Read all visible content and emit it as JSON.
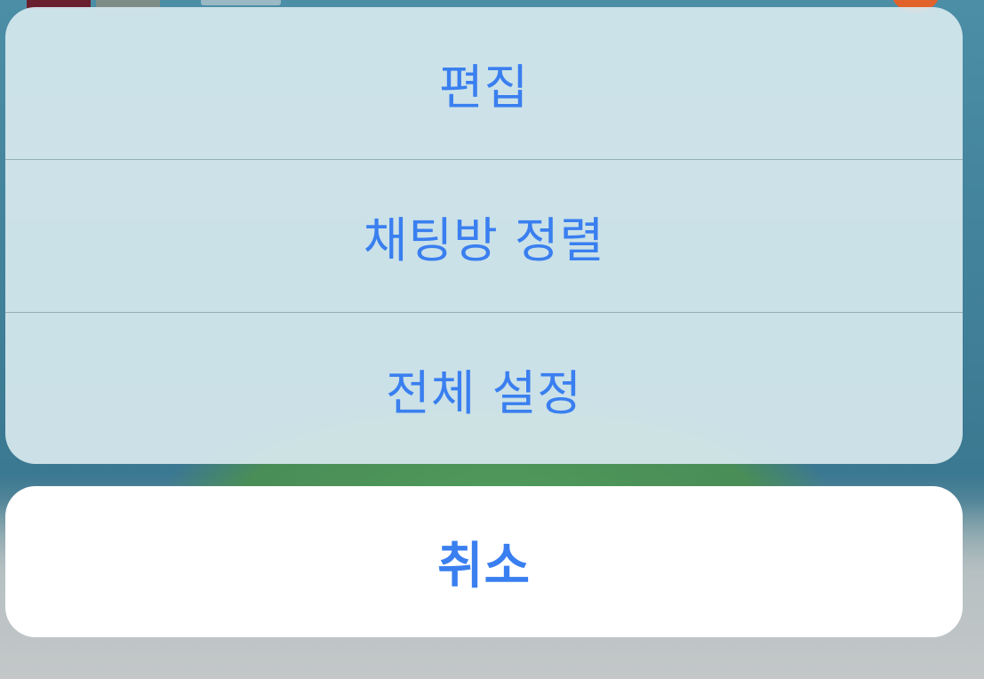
{
  "action_sheet": {
    "items": [
      {
        "label": "편집"
      },
      {
        "label": "채팅방 정렬"
      },
      {
        "label": "전체 설정"
      }
    ],
    "cancel_label": "취소"
  },
  "colors": {
    "accent": "#3a7ff0",
    "group_background": "#d6e8ee",
    "cancel_background": "#ffffff"
  }
}
